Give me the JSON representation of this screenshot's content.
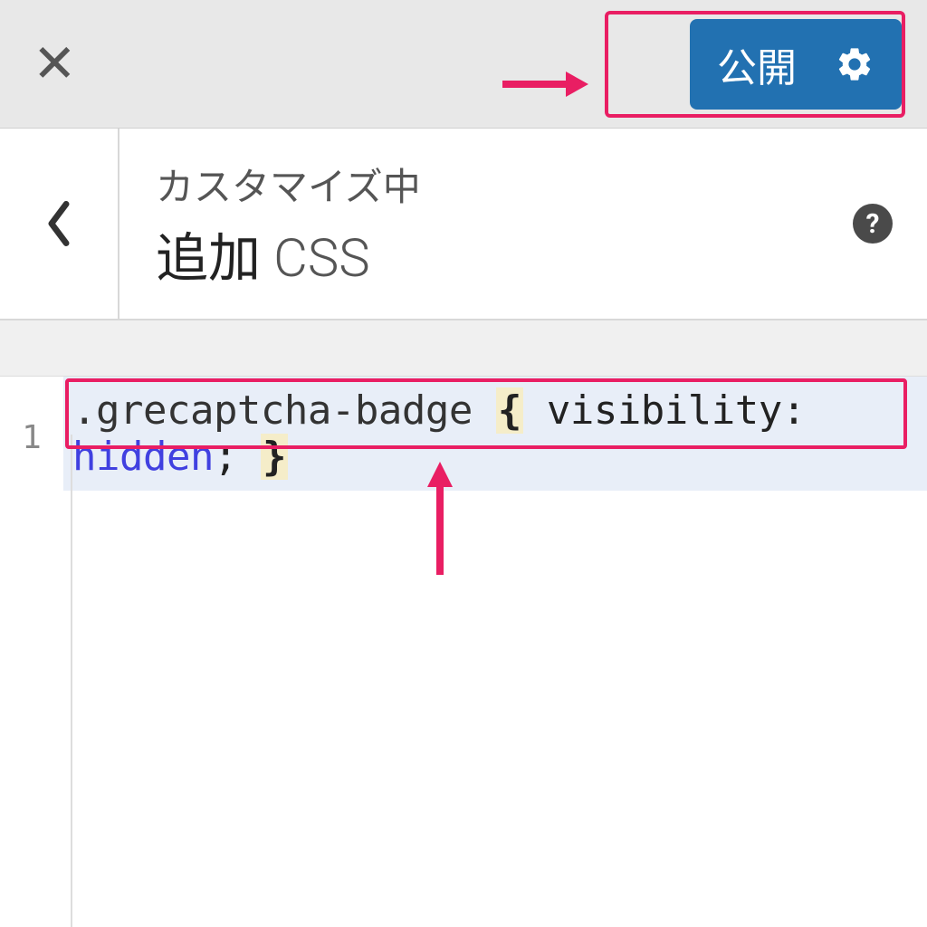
{
  "topBar": {
    "closeSymbol": "✕",
    "publishLabel": "公開"
  },
  "header": {
    "backSymbol": "‹",
    "subtitle": "カスタマイズ中",
    "titlePrefix": "追加",
    "titleSuffix": " CSS",
    "helpSymbol": "?"
  },
  "editor": {
    "lineNumber": "1",
    "code": {
      "selector": ".grecaptcha-badge",
      "braceOpen": "{",
      "property": "visibility:",
      "value": "hidden",
      "semicolon": ";",
      "braceClose": "}"
    }
  },
  "annotations": {
    "arrowRight": "→",
    "arrowUp": "↑"
  },
  "colors": {
    "accent": "#2271b1",
    "highlight": "#e91e63"
  }
}
